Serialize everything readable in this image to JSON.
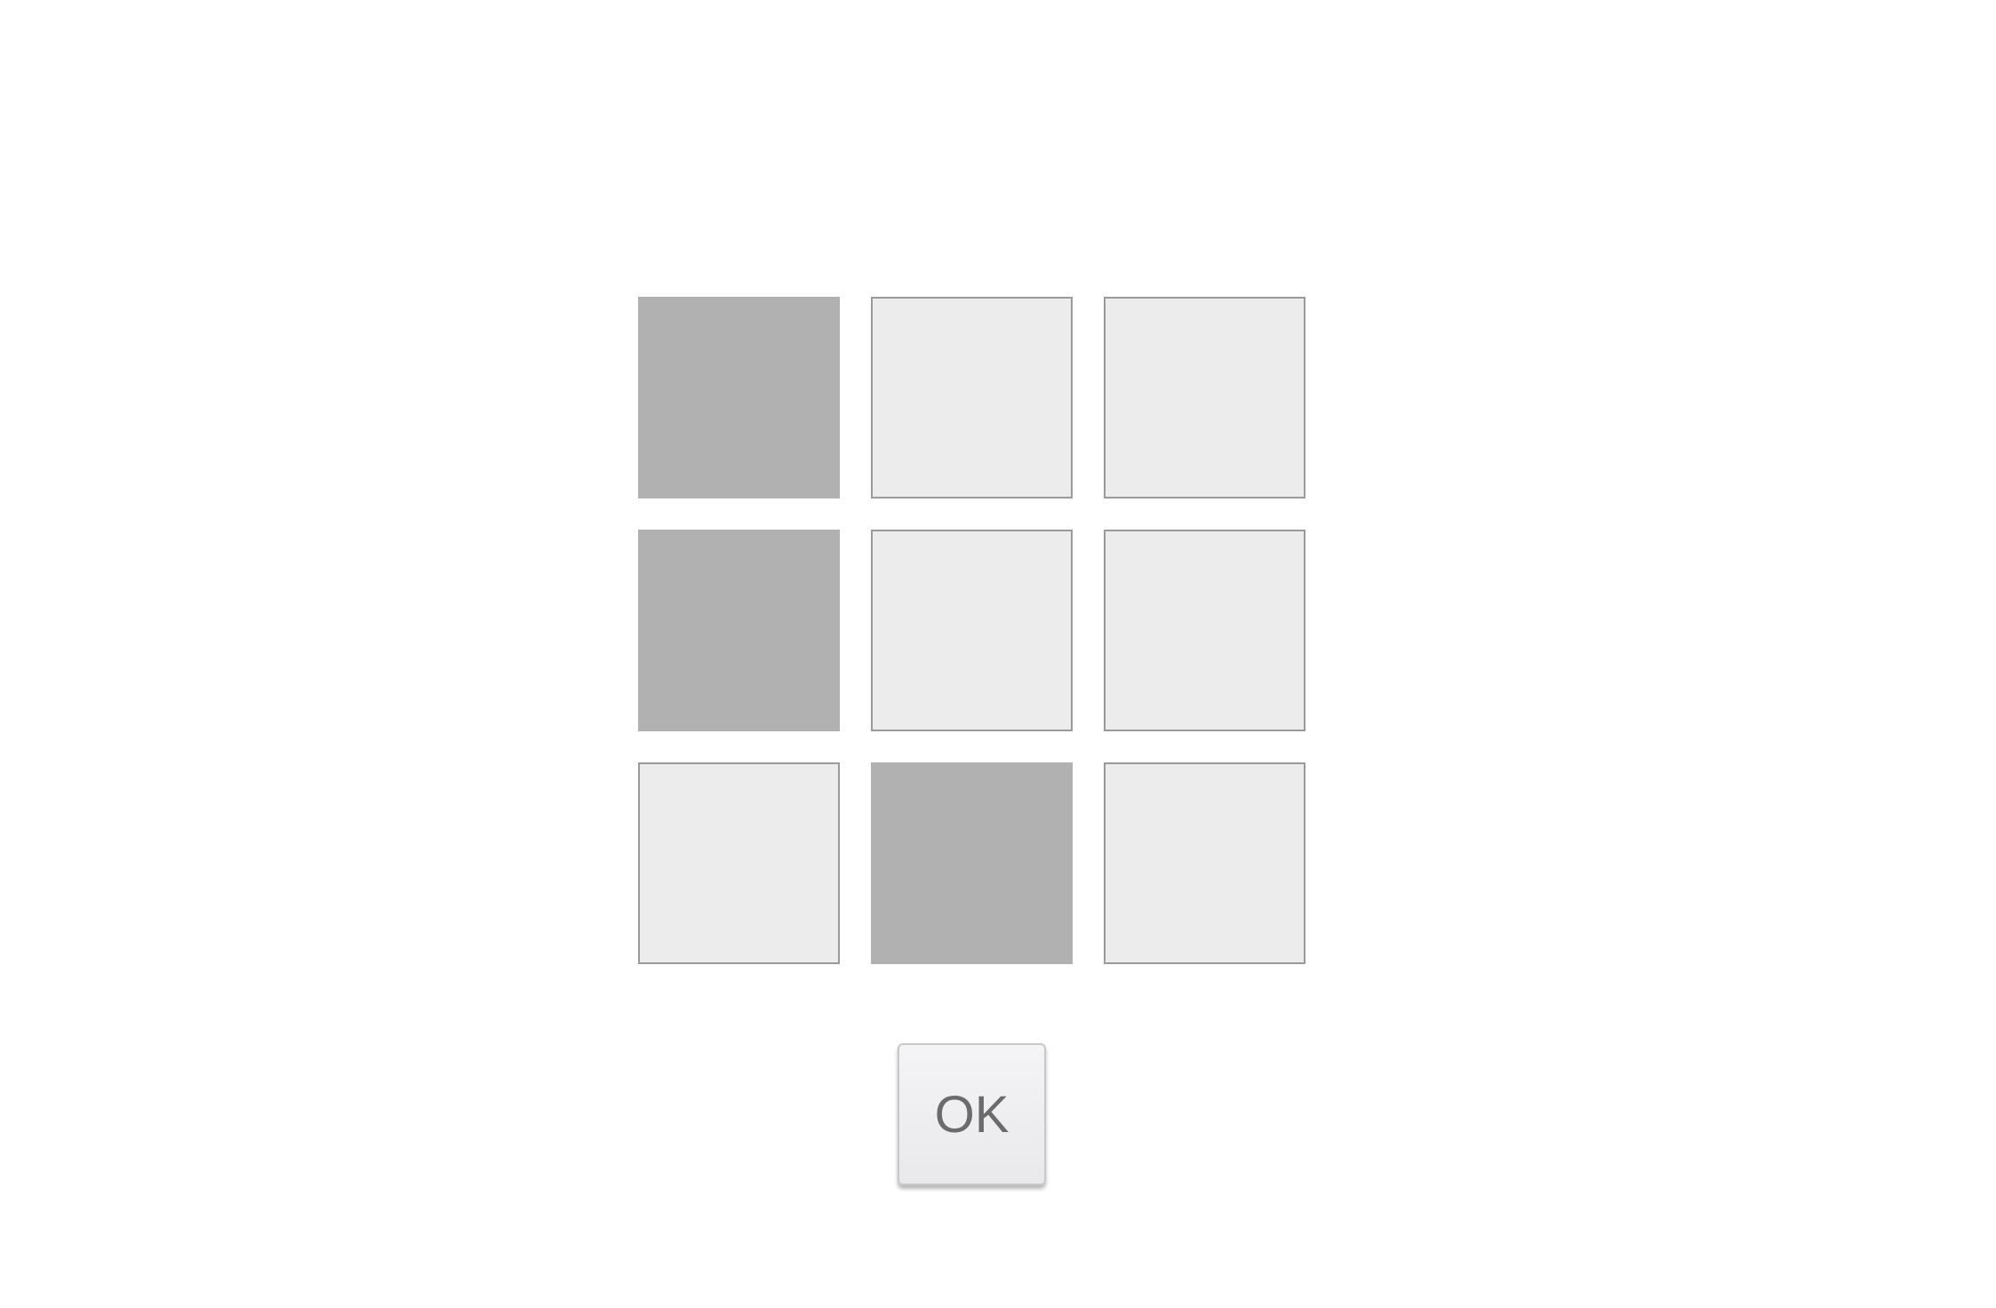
{
  "grid": {
    "rows": 3,
    "cols": 3,
    "cells": [
      {
        "row": 1,
        "col": 1,
        "selected": true
      },
      {
        "row": 1,
        "col": 2,
        "selected": false
      },
      {
        "row": 1,
        "col": 3,
        "selected": false
      },
      {
        "row": 2,
        "col": 1,
        "selected": true
      },
      {
        "row": 2,
        "col": 2,
        "selected": false
      },
      {
        "row": 2,
        "col": 3,
        "selected": false
      },
      {
        "row": 3,
        "col": 1,
        "selected": false
      },
      {
        "row": 3,
        "col": 2,
        "selected": true
      },
      {
        "row": 3,
        "col": 3,
        "selected": false
      }
    ]
  },
  "colors": {
    "selected_fill": "#b1b1b1",
    "unselected_fill": "#ececec",
    "cell_border": "#9a9a9a"
  },
  "ok_button": {
    "label": "OK"
  }
}
